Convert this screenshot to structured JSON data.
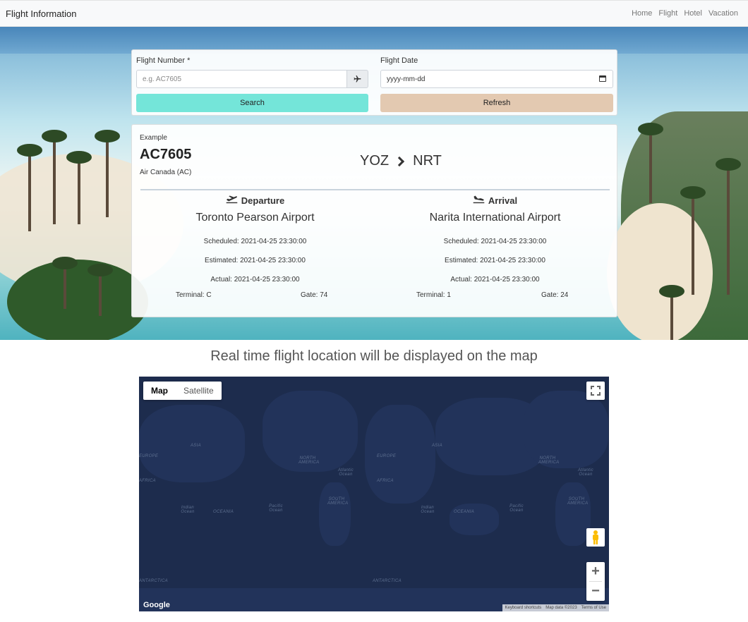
{
  "navbar": {
    "brand": "Flight Information",
    "links": [
      "Home",
      "Flight",
      "Hotel",
      "Vacation"
    ]
  },
  "search": {
    "flight_number_label": "Flight Number *",
    "flight_number_placeholder": "e.g. AC7605",
    "flight_date_label": "Flight Date",
    "flight_date_placeholder": "yyyy-mm-dd",
    "search_label": "Search",
    "refresh_label": "Refresh",
    "search_color": "#74e5d9",
    "refresh_color": "#e3c9b1"
  },
  "flight": {
    "example_label": "Example",
    "number": "AC7605",
    "airline": "Air Canada (AC)",
    "origin": "YOZ",
    "destination": "NRT",
    "departure": {
      "heading": "Departure",
      "airport": "Toronto Pearson Airport",
      "scheduled": "Scheduled: 2021-04-25 23:30:00",
      "estimated": "Estimated: 2021-04-25 23:30:00",
      "actual": "Actual: 2021-04-25 23:30:00",
      "terminal": "Terminal: C",
      "gate": "Gate: 74"
    },
    "arrival": {
      "heading": "Arrival",
      "airport": "Narita International Airport",
      "scheduled": "Scheduled: 2021-04-25 23:30:00",
      "estimated": "Estimated: 2021-04-25 23:30:00",
      "actual": "Actual: 2021-04-25 23:30:00",
      "terminal": "Terminal: 1",
      "gate": "Gate: 24"
    }
  },
  "map": {
    "caption": "Real time flight location will be displayed on the map",
    "type_map": "Map",
    "type_satellite": "Satellite",
    "zoom_in": "+",
    "zoom_out": "−",
    "logo": "Google",
    "attrib_shortcuts": "Keyboard shortcuts",
    "attrib_data": "Map data ©2023",
    "attrib_terms": "Terms of Use",
    "labels": {
      "asia_left": "ASIA",
      "asia_right": "ASIA",
      "europe_left": "EUROPE",
      "europe_right": "EUROPE",
      "na_left": "NORTH AMERICA",
      "na_right": "NORTH AMERICA",
      "africa_left": "AFRICA",
      "africa_right": "AFRICA",
      "sa_left": "SOUTH AMERICA",
      "sa_right": "SOUTH AMERICA",
      "oceania_left": "OCEANIA",
      "oceania_right": "OCEANIA",
      "antarctica_left": "ANTARCTICA",
      "antarctica_right": "ANTARCTICA",
      "atlantic_left": "Atlantic Ocean",
      "atlantic_right": "Atlantic Ocean",
      "pacific_left": "Pacific Ocean",
      "pacific_right": "Pacific Ocean",
      "indian_left": "Indian Ocean",
      "indian_right": "Indian Ocean"
    }
  }
}
